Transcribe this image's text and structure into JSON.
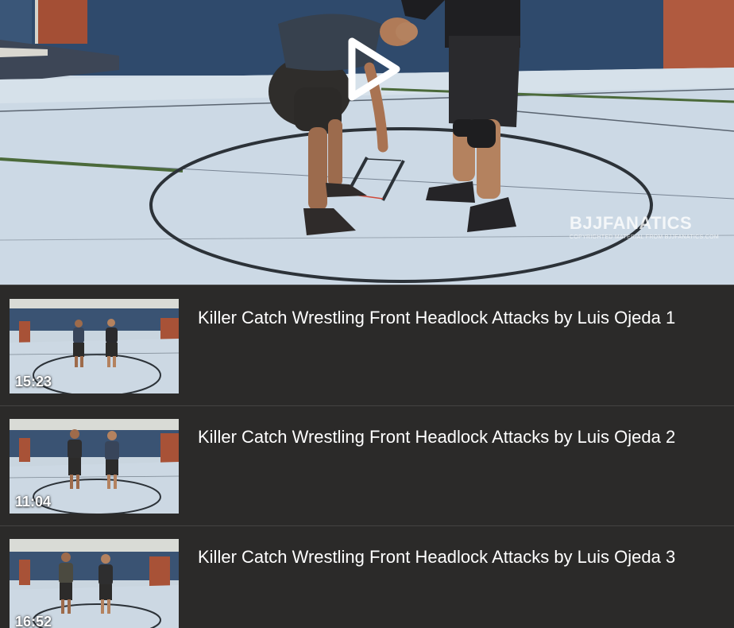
{
  "player": {
    "watermark": "BJJFANATICS",
    "watermark_sub": "COPYRIGHTED MATERIAL FROM BJJFANATICS.COM",
    "play_icon": "play-triangle-icon"
  },
  "playlist": {
    "items": [
      {
        "title": "Killer Catch Wrestling Front Headlock Attacks by Luis Ojeda 1",
        "duration": "15:23"
      },
      {
        "title": "Killer Catch Wrestling Front Headlock Attacks by Luis Ojeda 2",
        "duration": "11:04"
      },
      {
        "title": "Killer Catch Wrestling Front Headlock Attacks by Luis Ojeda 3",
        "duration": "16:52"
      }
    ]
  },
  "colors": {
    "background": "#2b2a29",
    "title_text": "#ffffff",
    "mat": "#cfdbe6",
    "wall": "#2e4766",
    "door": "#a64e35"
  }
}
